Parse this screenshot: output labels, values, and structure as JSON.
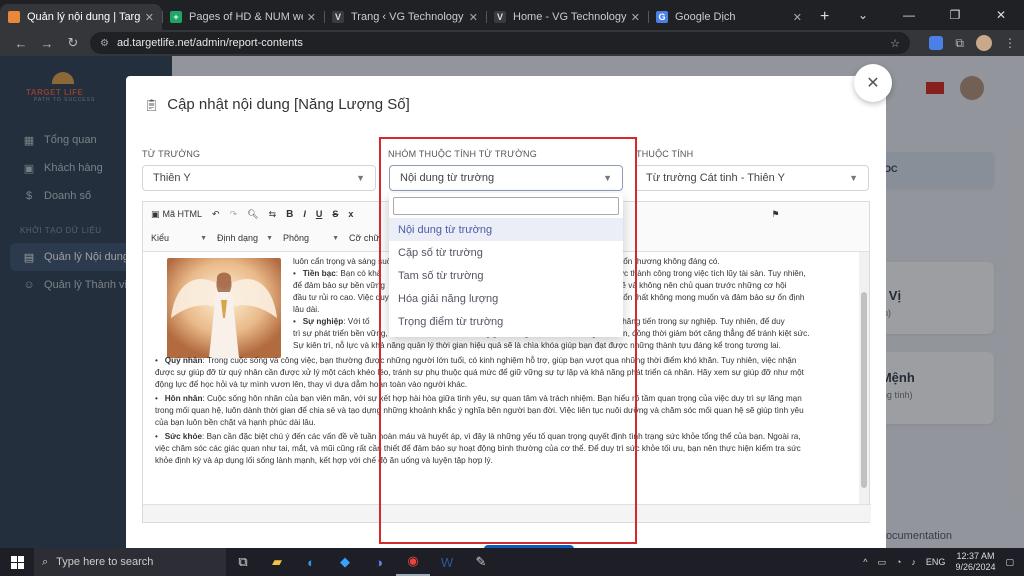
{
  "browser": {
    "tabs": [
      {
        "title": "Quản lý nội dung | Target Life",
        "fav_color": "#e8893a",
        "active": true
      },
      {
        "title": "Pages of HD & NUM web - Goo",
        "fav_color": "#1fa463",
        "active": false
      },
      {
        "title": "Trang ‹ VG Technology — Word",
        "fav_color": "#9aa0a6",
        "active": false
      },
      {
        "title": "Home - VG Technology",
        "fav_color": "#9aa0a6",
        "active": false
      },
      {
        "title": "Google Dịch",
        "fav_color": "#4a80e8",
        "active": false
      }
    ],
    "url": "ad.targetlife.net/admin/report-contents"
  },
  "sidebar": {
    "brand": "TARGET LIFE",
    "tagline": "PATH TO SUCCESS",
    "items": [
      {
        "label": "Tổng quan",
        "icon": "grid-icon"
      },
      {
        "label": "Khách hàng",
        "icon": "user-card-icon"
      },
      {
        "label": "Doanh số",
        "icon": "dollar-icon"
      }
    ],
    "section": "KHỞI TẠO DỮ LIỆU",
    "data_items": [
      {
        "label": "Quản lý Nội dung",
        "icon": "book-icon",
        "active": true
      },
      {
        "label": "Quản lý Thành viên",
        "icon": "users-icon",
        "active": false
      }
    ]
  },
  "background": {
    "card1_big": "ục Vị",
    "card1_small": "Tính)",
    "card2_big": "c Mệnh",
    "card2_small": "ượng tính)",
    "card0_text": "OC",
    "doc_link": "Documentation"
  },
  "modal": {
    "title": "Cập nhật nội dung [Năng Lượng Số]",
    "field1": {
      "label": "TỪ TRƯỜNG",
      "value": "Thiên Y"
    },
    "field2": {
      "label": "NHÓM THUỘC TÍNH TỪ TRƯỜNG",
      "value": "Nội dung từ trường"
    },
    "field3": {
      "label": "THUỘC TÍNH",
      "value": "Từ trường Cát tinh - Thiên Y"
    },
    "toolbar": {
      "html": "Mã HTML",
      "style": "Kiểu",
      "format": "Định dạng",
      "font": "Phông",
      "size": "Cỡ chữ"
    },
    "content": [
      {
        "text": "luôn cẩn trọng và sáng suốt",
        "tail": "những tổn thương không đáng có."
      },
      {
        "bold": "Tiền bạc",
        "text": ": Bạn có khả",
        "tail": "đạt được thành công trong việc tích lũy tài sản. Tuy nhiên,"
      },
      {
        "text": "để đảm bảo sự bền vững",
        "tail": "chặt chẽ và không nên chủ quan trước những cơ hội"
      },
      {
        "text": "đầu tư rủi ro cao. Việc duy",
        "tail": "những tổn thất không mong muốn và đảm bảo sự ổn định"
      },
      {
        "text": "lâu dài."
      },
      {
        "bold": "Sự nghiệp",
        "text": ": Với tố",
        "tail": "cơ hội thăng tiến trong sự nghiệp. Tuy nhiên, để duy"
      },
      {
        "text": "trì sự phát triển bền vững, bạn cần học cách cân bằng giữa công việc và cuộc sống cá nhân, đồng thời giảm bớt căng thẳng để tránh kiệt sức."
      },
      {
        "text": "Sự kiên trì, nỗ lực và khả năng quản lý thời gian hiệu quả sẽ là chìa khóa giúp bạn đạt được những thành tựu đáng kể trong tương lai."
      },
      {
        "bold": "Quý nhân",
        "text": ": Trong cuộc sống và công việc, bạn thường được những người lớn tuổi, có kinh nghiệm hỗ trợ, giúp bạn vượt qua những thời điểm khó khăn. Tuy nhiên, việc nhận"
      },
      {
        "text": "được sự giúp đỡ từ quý nhân cần được xử lý một cách khéo léo, tránh sự phụ thuộc quá mức để giữ vững sự tự lập và khả năng phát triển cá nhân. Hãy xem sự giúp đỡ như một"
      },
      {
        "text": "động lực để học hỏi và tự mình vươn lên, thay vì dựa dẫm hoàn toàn vào người khác."
      },
      {
        "bold": "Hôn nhân",
        "text": ": Cuộc sống hôn nhân của bạn viên mãn, với sự kết hợp hài hòa giữa tình yêu, sự quan tâm và trách nhiệm. Bạn hiểu rõ tầm quan trọng của việc duy trì sự lãng mạn"
      },
      {
        "text": "trong mối quan hệ, luôn dành thời gian để chia sẻ và tạo dựng những khoảnh khắc ý nghĩa bên người bạn đời. Việc liên tục nuôi dưỡng và chăm sóc mối quan hệ sẽ giúp tình yêu"
      },
      {
        "text": "của bạn luôn bền chặt và hạnh phúc dài lâu."
      },
      {
        "bold": "Sức khỏe",
        "text": ": Bạn cần đặc biệt chú ý đến các vấn đề về tuần hoàn máu và huyết áp, vì đây là những yếu tố quan trọng quyết định tình trạng sức khỏe tổng thể của bạn. Ngoài ra,"
      },
      {
        "text": "việc chăm sóc các giác quan như tai, mắt, và mũi cũng rất cần thiết để đảm bảo sự hoạt động bình thường của cơ thể. Để duy trì sức khỏe tối ưu, bạn nên thực hiện kiểm tra sức"
      },
      {
        "text": "khỏe định kỳ và áp dụng lối sống lành mạnh, kết hợp với chế độ ăn uống và luyện tập hợp lý."
      }
    ],
    "dropdown_options": [
      "Nội dung từ trường",
      "Cặp số từ trường",
      "Tam số từ trường",
      "Hóa giải năng lượng",
      "Trọng điểm từ trường"
    ]
  },
  "taskbar": {
    "search": "Type here to search",
    "lang": "ENG",
    "time": "12:37 AM",
    "date": "9/26/2024"
  }
}
